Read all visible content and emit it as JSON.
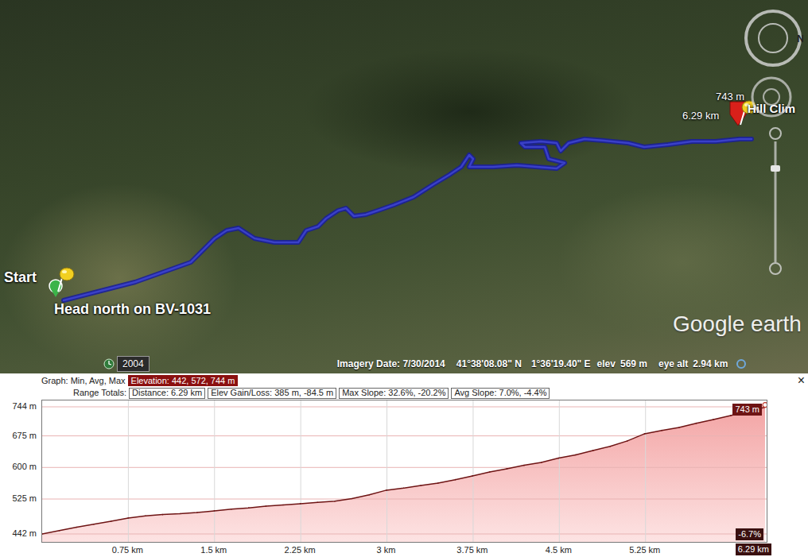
{
  "map": {
    "pins": [
      {
        "kind": "start",
        "label": "Start",
        "note": "Head north on BV-1031",
        "color": "#3cb44a"
      },
      {
        "kind": "end",
        "label": "Hill Clim",
        "elevation": "743 m",
        "distance": "6.29 km",
        "color": "#d9201a"
      }
    ],
    "compass": "N",
    "logo": "Google earth",
    "status": {
      "year": "2004",
      "imagery_date": "Imagery Date: 7/30/2014",
      "latitude": "41°38'08.08\" N",
      "longitude": "1°36'19.40\" E",
      "elevation_label": "elev",
      "elevation": "569 m",
      "eye_alt_label": "eye alt",
      "eye_alt": "2.94 km"
    }
  },
  "graph": {
    "label": "Graph: Min, Avg, Max",
    "elevation": "Elevation: 442, 572, 744 m",
    "totals_label": "Range Totals:",
    "totals": [
      "Distance: 6.29 km",
      "Elev Gain/Loss: 385 m, -84.5 m",
      "Max Slope: 32.6%, -20.2%",
      "Avg Slope: 7.0%, -4.4%"
    ],
    "close": "×"
  },
  "chart": {
    "y_ticks": [
      {
        "label": "744 m",
        "value": 744
      },
      {
        "label": "675 m",
        "value": 675
      },
      {
        "label": "600 m",
        "value": 600
      },
      {
        "label": "525 m",
        "value": 525
      },
      {
        "label": "442 m",
        "value": 442
      }
    ],
    "x_ticks": [
      {
        "label": "0.75 km",
        "value": 0.75
      },
      {
        "label": "1.5 km",
        "value": 1.5
      },
      {
        "label": "2.25 km",
        "value": 2.25
      },
      {
        "label": "3 km",
        "value": 3
      },
      {
        "label": "3.75 km",
        "value": 3.75
      },
      {
        "label": "4.5 km",
        "value": 4.5
      },
      {
        "label": "5.25 km",
        "value": 5.25
      }
    ],
    "end_label": "6.29 km",
    "distance_max": 6.29,
    "cursor_reading": "743 m",
    "cursor_slope": "-6.7%",
    "series": [
      {
        "name": "elevation",
        "values": [
          442,
          450,
          458,
          465,
          472,
          480,
          485,
          488,
          490,
          493,
          497,
          501,
          504,
          508,
          511,
          514,
          517,
          520,
          526,
          535,
          546,
          551,
          557,
          563,
          571,
          580,
          589,
          597,
          605,
          612,
          622,
          630,
          640,
          650,
          663,
          680,
          688,
          695,
          705,
          714,
          723,
          733,
          743
        ]
      }
    ]
  }
}
